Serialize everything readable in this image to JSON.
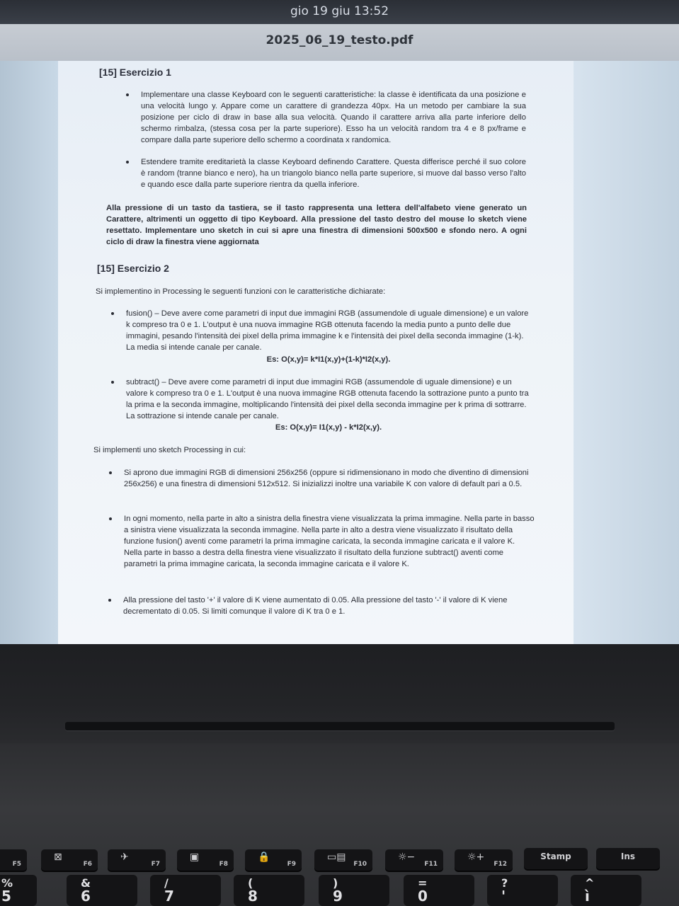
{
  "system": {
    "clock": "gio 19 giu  13:52"
  },
  "viewer": {
    "title": "2025_06_19_testo.pdf"
  },
  "doc": {
    "ex1_title": "[15] Esercizio 1",
    "ex1_b1": "Implementare una classe Keyboard con le seguenti caratteristiche: la classe è identificata da una posizione e una velocità lungo y. Appare come un carattere di grandezza 40px. Ha un metodo per cambiare la sua posizione per ciclo di draw in base alla sua velocità. Quando il carattere arriva alla parte inferiore dello schermo rimbalza, (stessa cosa per la parte superiore). Esso ha un velocità random tra 4 e 8 px/frame e compare dalla parte superiore dello schermo a coordinata x randomica.",
    "ex1_b2": "Estendere tramite ereditarietà la classe Keyboard definendo Carattere. Questa differisce perché il suo colore è random (tranne bianco e nero), ha un triangolo bianco nella parte superiore, si muove dal basso verso l'alto e quando esce dalla parte superiore rientra da quella inferiore.",
    "ex1_p": "Alla pressione di un tasto da tastiera, se il tasto rappresenta una lettera dell'alfabeto viene generato un Carattere, altrimenti un oggetto di tipo Keyboard. Alla pressione del tasto destro del mouse lo sketch viene resettato. Implementare uno sketch in cui si apre una finestra di dimensioni 500x500 e sfondo nero. A ogni ciclo di draw la finestra viene aggiornata",
    "ex2_title": "[15] Esercizio 2",
    "ex2_intro": "Si implementino in Processing le seguenti funzioni con le caratteristiche dichiarate:",
    "ex2_b1": "fusion() – Deve avere come parametri di input due immagini RGB (assumendole di uguale dimensione) e un valore k compreso tra 0 e 1. L'output è una nuova immagine RGB ottenuta facendo la media punto a punto delle due immagini, pesando l'intensità dei pixel della prima immagine k e l'intensità dei pixel della seconda immagine (1-k). La media si intende canale per canale.",
    "ex2_f1": "Es: O(x,y)= k*I1(x,y)+(1-k)*I2(x,y).",
    "ex2_b2": "subtract() – Deve avere come parametri di input due immagini RGB (assumendole di uguale dimensione) e un valore k compreso tra 0 e 1. L'output è una nuova immagine RGB ottenuta facendo la sottrazione punto a punto tra la prima e la seconda immagine, moltiplicando l'intensità dei pixel della seconda immagine per k prima di sottrarre. La sottrazione si intende canale per canale.",
    "ex2_f2": "Es: O(x,y)= I1(x,y) - k*I2(x,y).",
    "ex2_sketch": "Si implementi uno sketch Processing in cui:",
    "ex2_s1": "Si aprono due immagini RGB di dimensioni 256x256 (oppure si ridimensionano in modo che diventino di dimensioni 256x256) e una finestra di dimensioni 512x512. Si inizializzi inoltre una variabile K con valore di default pari a 0.5.",
    "ex2_s2": "In ogni momento, nella parte in alto a sinistra della finestra viene visualizzata la prima immagine. Nella parte in basso a sinistra viene visualizzata la seconda immagine. Nella parte in alto a destra viene visualizzato il risultato della funzione fusion() aventi come parametri la prima immagine caricata, la seconda immagine caricata e il valore K. Nella parte in basso a destra della finestra viene visualizzato il risultato della funzione subtract() aventi come parametri la prima immagine caricata, la seconda immagine caricata e il valore K.",
    "ex2_s3": "Alla pressione del tasto '+' il valore di K viene aumentato di 0.05. Alla pressione del tasto '-' il valore di K viene decrementato di 0.05. Si limiti comunque il valore di K tra 0 e 1."
  },
  "keyboard": {
    "fkeys": [
      {
        "label": "F5",
        "icon": ""
      },
      {
        "label": "F6",
        "icon": "⊠"
      },
      {
        "label": "F7",
        "icon": "✈"
      },
      {
        "label": "F8",
        "icon": "▣"
      },
      {
        "label": "F9",
        "icon": "🔒"
      },
      {
        "label": "F10",
        "icon": "▭▤"
      },
      {
        "label": "F11",
        "icon": "☼−"
      },
      {
        "label": "F12",
        "icon": "☼+"
      },
      {
        "label": "Stamp",
        "icon": ""
      },
      {
        "label": "Ins",
        "icon": ""
      }
    ],
    "numkeys": [
      {
        "top": "%",
        "bot": "5"
      },
      {
        "top": "&",
        "bot": "6"
      },
      {
        "top": "/",
        "bot": "7"
      },
      {
        "top": "(",
        "bot": "8"
      },
      {
        "top": ")",
        "bot": "9"
      },
      {
        "top": "=",
        "bot": "0"
      },
      {
        "top": "?",
        "bot": "'"
      },
      {
        "top": "^",
        "bot": "ì"
      }
    ]
  }
}
